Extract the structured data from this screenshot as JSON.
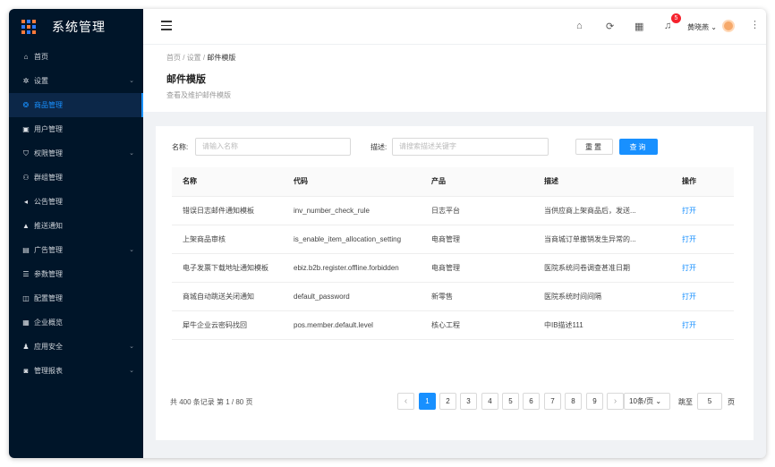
{
  "app": {
    "title": "系统管理"
  },
  "sidebar": {
    "items": [
      {
        "label": "首页",
        "icon": "home-icon",
        "glyph": "⌂",
        "arrow": ""
      },
      {
        "label": "设置",
        "icon": "gear-icon",
        "glyph": "✲",
        "arrow": "⌄"
      },
      {
        "label": "商品管理",
        "icon": "shop-icon",
        "glyph": "❂",
        "arrow": "",
        "active": true
      },
      {
        "label": "用户管理",
        "icon": "user-icon",
        "glyph": "▣",
        "arrow": ""
      },
      {
        "label": "权限管理",
        "icon": "shield-icon",
        "glyph": "⛉",
        "arrow": "⌄"
      },
      {
        "label": "群组管理",
        "icon": "group-icon",
        "glyph": "⚇",
        "arrow": ""
      },
      {
        "label": "公告管理",
        "icon": "speaker-icon",
        "glyph": "◂",
        "arrow": ""
      },
      {
        "label": "推送通知",
        "icon": "bell-icon",
        "glyph": "▲",
        "arrow": ""
      },
      {
        "label": "广告管理",
        "icon": "image-icon",
        "glyph": "▤",
        "arrow": "⌄"
      },
      {
        "label": "参数管理",
        "icon": "list-icon",
        "glyph": "☰",
        "arrow": ""
      },
      {
        "label": "配置管理",
        "icon": "config-icon",
        "glyph": "◫",
        "arrow": ""
      },
      {
        "label": "企业概览",
        "icon": "grid-icon",
        "glyph": "▦",
        "arrow": ""
      },
      {
        "label": "应用安全",
        "icon": "person-icon",
        "glyph": "♟",
        "arrow": "⌄"
      },
      {
        "label": "管理报表",
        "icon": "report-icon",
        "glyph": "◙",
        "arrow": "⌄"
      }
    ]
  },
  "topbar": {
    "menu_icon": "hamburger-icon",
    "icons": [
      "home-icon",
      "refresh-icon",
      "apps-icon",
      "bell-icon"
    ],
    "notification_count": "5",
    "username": "黄晓燕 ⌄"
  },
  "header": {
    "breadcrumb": [
      "首页",
      "设置",
      "邮件模版"
    ],
    "title": "邮件模版",
    "description": "查看及维护邮件模版"
  },
  "filters": {
    "name_label": "名称:",
    "name_placeholder": "请输入名称",
    "desc_label": "描述:",
    "desc_placeholder": "请搜索描述关键字",
    "reset": "重置",
    "query": "查询"
  },
  "table": {
    "columns": [
      "名称",
      "代码",
      "产品",
      "描述",
      "操作"
    ],
    "rows": [
      [
        "错误日志邮件通知模板",
        "inv_number_check_rule",
        "日志平台",
        "当供应商上架商品后，发送...",
        "打开"
      ],
      [
        "上架商品审核",
        "is_enable_item_allocation_setting",
        "电商管理",
        "当商城订单撤销发生异常的...",
        "打开"
      ],
      [
        "电子发票下载地址通知模板",
        "ebiz.b2b.register.offline.forbidden",
        "电商管理",
        "医院系统问卷调查甚准日期",
        "打开"
      ],
      [
        "商城自动跳送关闭通知",
        "default_password",
        "新零售",
        "医院系统时间间隔",
        "打开"
      ],
      [
        "犀牛企业云密码找回",
        "pos.member.default.level",
        "核心工程",
        "中IB描述111",
        "打开"
      ]
    ]
  },
  "pagination": {
    "total": "共 400 条记录 第 1 / 80 页",
    "prev": "‹",
    "next": "›",
    "pages": [
      "1",
      "2",
      "3",
      "4",
      "5",
      "6",
      "7",
      "8",
      "9"
    ],
    "current": "1",
    "page_size": "10条/页 ⌄",
    "jump_label": "跳至",
    "jump_value": "5",
    "page_suffix": "页"
  },
  "colors": {
    "accent": "#1890ff",
    "sidebar_bg": "#001529",
    "badge": "#f5222d"
  }
}
